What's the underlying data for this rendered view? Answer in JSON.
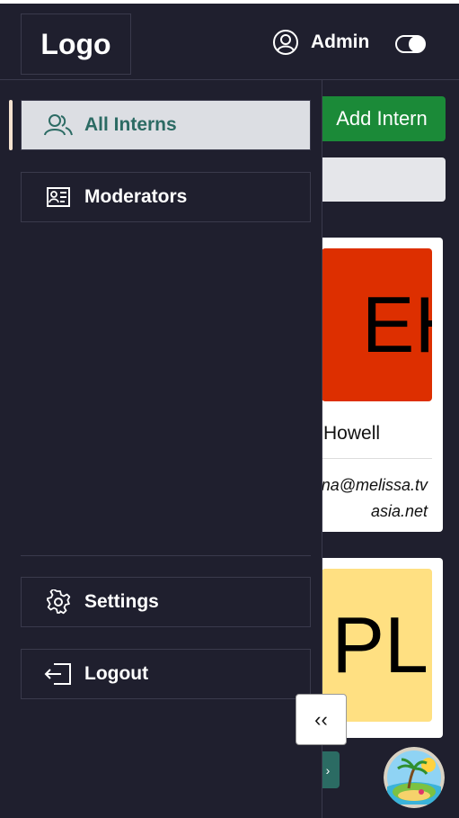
{
  "header": {
    "logo": "Logo",
    "user_name": "Admin",
    "theme_toggle_on": true
  },
  "main": {
    "add_button": "Add Intern",
    "cards": [
      {
        "initials": "EH",
        "name": "Howell",
        "email_lines": [
          "na@melissa.tv",
          "asia.net"
        ],
        "avatar_color": "#dd2f00"
      },
      {
        "initials": "PL",
        "avatar_color": "#ffe082"
      }
    ],
    "pager_next": "›"
  },
  "sidebar": {
    "items": [
      {
        "label": "All Interns",
        "icon": "users-icon",
        "active": true
      },
      {
        "label": "Moderators",
        "icon": "id-card-icon",
        "active": false
      }
    ],
    "bottom_items": [
      {
        "label": "Settings",
        "icon": "gear-icon"
      },
      {
        "label": "Logout",
        "icon": "logout-icon"
      }
    ],
    "collapse_label": "‹‹"
  },
  "colors": {
    "accent": "#2c6b64",
    "add_button": "#1b8a38",
    "background": "#1f1f2e"
  }
}
